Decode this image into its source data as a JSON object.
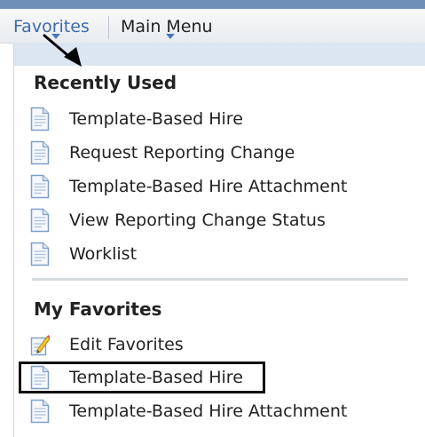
{
  "menu_bar": {
    "favorites_label": "Favorites",
    "main_menu_label": "Main Menu"
  },
  "favorites_menu": {
    "recently_used": {
      "title": "Recently Used",
      "items": [
        {
          "label": "Template-Based Hire",
          "icon": "document-icon"
        },
        {
          "label": "Request Reporting Change",
          "icon": "document-icon"
        },
        {
          "label": "Template-Based Hire Attachment",
          "icon": "document-icon"
        },
        {
          "label": "View Reporting Change Status",
          "icon": "document-icon"
        },
        {
          "label": "Worklist",
          "icon": "document-icon"
        }
      ]
    },
    "my_favorites": {
      "title": "My Favorites",
      "items": [
        {
          "label": "Edit Favorites",
          "icon": "edit-pencil-icon"
        },
        {
          "label": "Template-Based Hire",
          "icon": "document-icon"
        },
        {
          "label": "Template-Based Hire Attachment",
          "icon": "document-icon"
        }
      ]
    }
  },
  "colors": {
    "top_bar": "#6f8fb8",
    "favorites_link": "#3e6aa8",
    "header_band": "#dbe6f2",
    "highlight_border": "#111111",
    "annotation_arrow": "#000000"
  }
}
